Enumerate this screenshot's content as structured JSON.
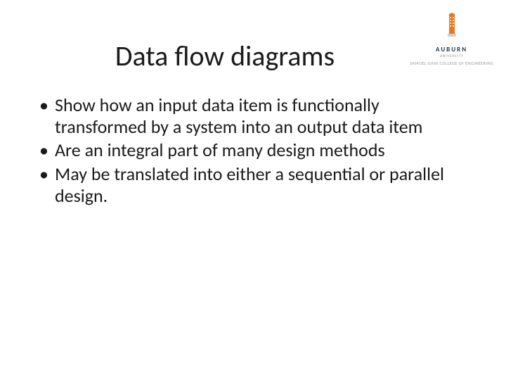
{
  "logo": {
    "name": "AUBURN",
    "line1": "UNIVERSITY",
    "line2": "SAMUEL GINN COLLEGE OF ENGINEERING"
  },
  "title": "Data flow diagrams",
  "bullets": [
    "Show how an input data item is functionally transformed by a system into an output data item",
    "Are an integral part of many design methods",
    "May be translated into either a sequential or parallel design."
  ]
}
